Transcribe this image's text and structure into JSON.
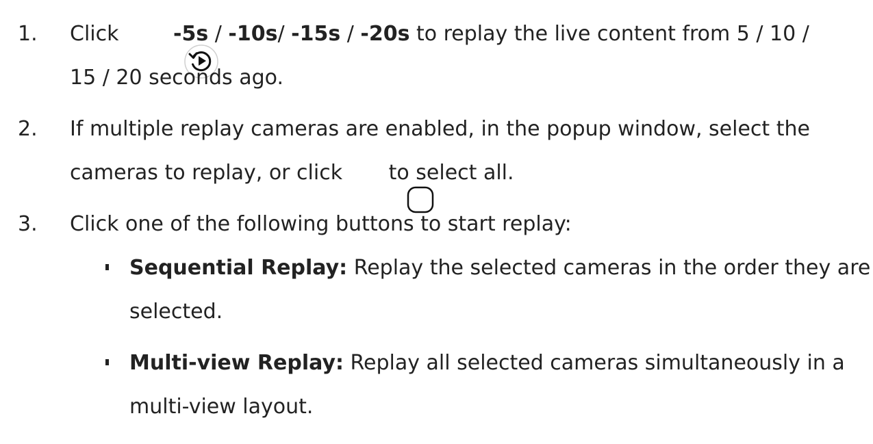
{
  "steps": [
    {
      "number": "1.",
      "lead": "Click",
      "icon": "replay-icon",
      "options": [
        "-5s",
        "-10s",
        "-15s",
        "-20s"
      ],
      "sep_1": " / ",
      "sep_2": "/ ",
      "sep_3": " / ",
      "text_after": " to replay the live content from 5 / 10 /",
      "line2": "15 / 20 seconds ago."
    },
    {
      "number": "2.",
      "line1": "If multiple replay cameras are enabled, in the popup window, select the",
      "line2_before": "cameras to replay, or click",
      "icon": "checkbox-icon",
      "line2_after": "to select all."
    },
    {
      "number": "3.",
      "line1": "Click one of the following buttons to start replay:",
      "bullets": [
        {
          "term": "Sequential Replay",
          "colon": ":",
          "line1": " Replay the selected cameras in the order they are",
          "line2": "selected."
        },
        {
          "term": "Multi-view Replay",
          "colon": ":",
          "line1": " Replay all selected cameras simultaneously in a",
          "line2": "multi-view layout."
        }
      ]
    }
  ],
  "colors": {
    "text": "#222222",
    "icon_stroke": "#111111",
    "icon_ring": "#cfcfcf"
  }
}
